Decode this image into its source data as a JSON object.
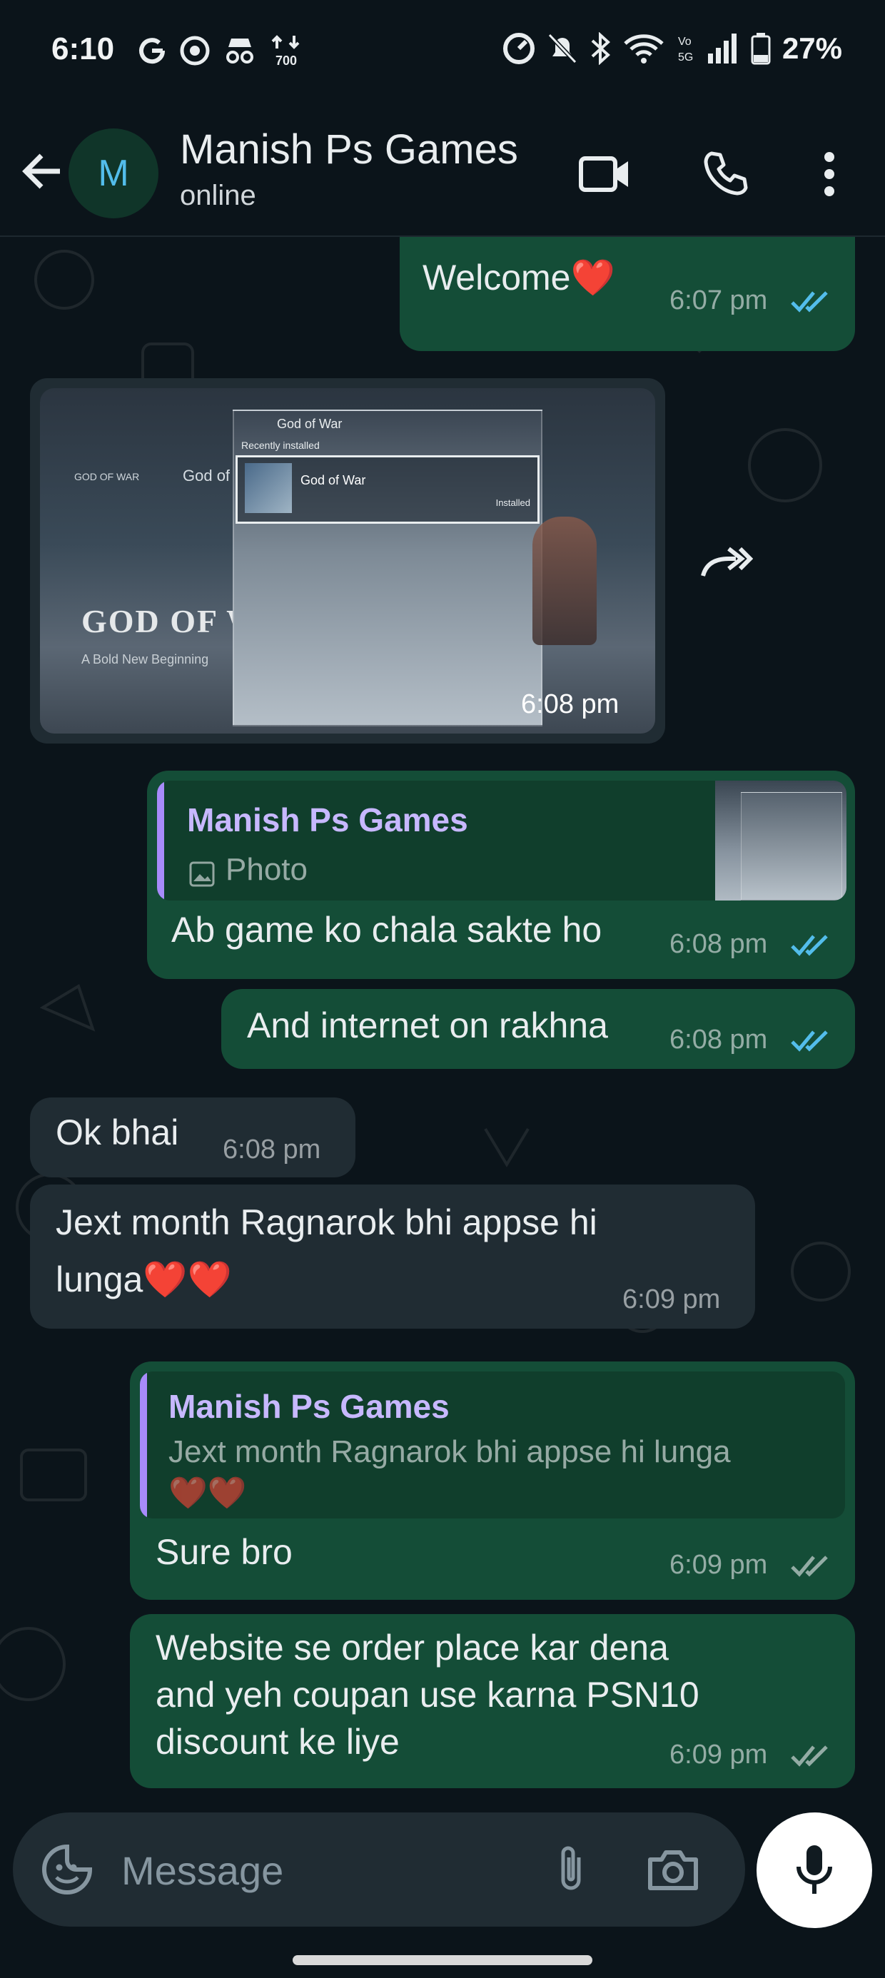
{
  "status_bar": {
    "time": "6:10",
    "left_icons": [
      "google-icon",
      "app-icon",
      "spy-icon",
      "data-700-icon"
    ],
    "battery": "27%",
    "data_speed": "700"
  },
  "header": {
    "avatar_letter": "M",
    "contact_name": "Manish Ps Games",
    "status": "online"
  },
  "messages": [
    {
      "id": "m1",
      "text": "Welcome❤️",
      "time": "6:07 pm",
      "read": true
    },
    {
      "id": "m2",
      "type": "photo",
      "time": "6:08 pm",
      "photo": {
        "panel_title": "God of War",
        "recent": "Recently installed",
        "item": "God of War",
        "item_status": "Installed",
        "logo": "GOD OF WAR",
        "tagline": "A Bold New Beginning",
        "tab1": "GOD OF WAR",
        "tab2": "God of W"
      }
    },
    {
      "id": "m3",
      "quote_author": "Manish Ps Games",
      "quote_text": "Photo",
      "text": "Ab game ko chala sakte ho",
      "time": "6:08 pm",
      "read": true
    },
    {
      "id": "m4",
      "text": "And internet on rakhna",
      "time": "6:08 pm",
      "read": true
    },
    {
      "id": "m5",
      "text": "Ok bhai",
      "time": "6:08 pm"
    },
    {
      "id": "m6",
      "line1": "Jext month Ragnarok bhi appse hi",
      "line2": "lunga❤️❤️",
      "time": "6:09 pm"
    },
    {
      "id": "m7",
      "quote_author": "Manish Ps Games",
      "quote_text": "Jext month Ragnarok bhi appse hi lunga",
      "quote_line2": "❤️❤️",
      "text": "Sure bro",
      "time": "6:09 pm",
      "read": false
    },
    {
      "id": "m8",
      "line1": "Website se order place kar dena",
      "line2": "and yeh coupan use karna PSN10",
      "line3": "discount ke liye",
      "time": "6:09 pm",
      "read": false
    }
  ],
  "composer": {
    "placeholder": "Message"
  },
  "colors": {
    "outgoing": "#144d37",
    "incoming": "#202c33",
    "read_tick": "#53bdeb",
    "quote_author": "#c7b8ff"
  }
}
